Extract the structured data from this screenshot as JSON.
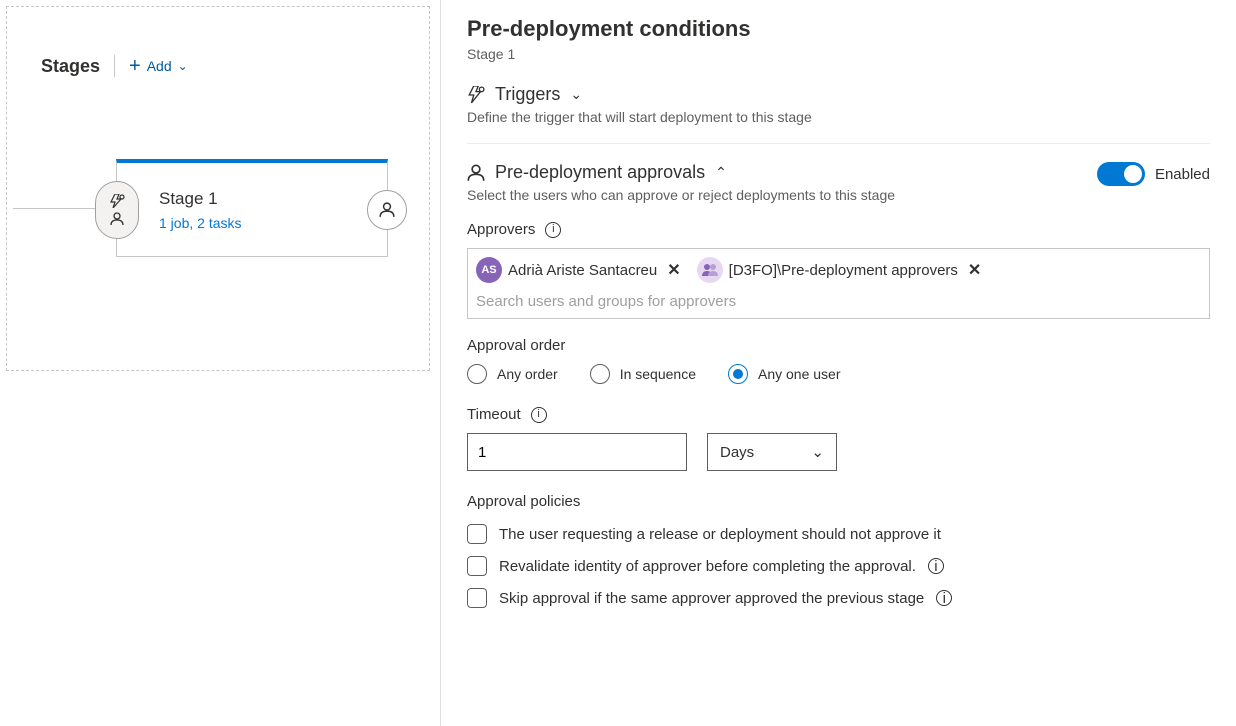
{
  "left": {
    "stages_label": "Stages",
    "add_label": "Add",
    "stage": {
      "name": "Stage 1",
      "subtitle": "1 job, 2 tasks"
    }
  },
  "panel": {
    "title": "Pre-deployment conditions",
    "subtitle": "Stage 1"
  },
  "triggers": {
    "heading": "Triggers",
    "description": "Define the trigger that will start deployment to this stage"
  },
  "approvals": {
    "heading": "Pre-deployment approvals",
    "description": "Select the users who can approve or reject deployments to this stage",
    "enabled_label": "Enabled",
    "approvers_label": "Approvers",
    "search_placeholder": "Search users and groups for approvers",
    "chips": [
      {
        "initials": "AS",
        "name": "Adrià Ariste Santacreu",
        "type": "user"
      },
      {
        "initials": "",
        "name": "[D3FO]\\Pre-deployment approvers",
        "type": "group"
      }
    ]
  },
  "order": {
    "label": "Approval order",
    "options": {
      "any": "Any order",
      "seq": "In sequence",
      "one": "Any one user"
    }
  },
  "timeout": {
    "label": "Timeout",
    "value": "1",
    "unit": "Days"
  },
  "policies": {
    "label": "Approval policies",
    "items": [
      "The user requesting a release or deployment should not approve it",
      "Revalidate identity of approver before completing the approval.",
      "Skip approval if the same approver approved the previous stage"
    ]
  }
}
